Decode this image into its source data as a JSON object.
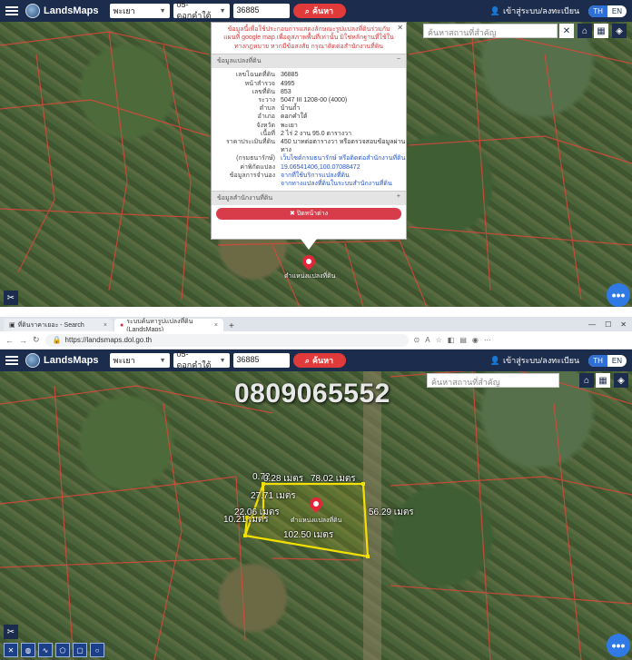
{
  "app": {
    "brand": "LandsMaps",
    "login": "เข้าสู่ระบบ/ลงทะเบียน",
    "lang_th": "TH",
    "lang_en": "EN"
  },
  "search": {
    "province": "พะเยา",
    "district": "05-ดอกคำใต้",
    "parcel_no": "36885",
    "button": "ค้นหา",
    "place_placeholder": "ค้นหาสถานที่สำคัญ"
  },
  "popup": {
    "note": "ข้อมูลนี้เพื่อใช้ประกอบการแสดงลักษณะรูปแปลงที่ดินร่วมกับแผนที่ google map เพื่อดูสภาพพื้นที่เท่านั้น มิใช่หลักฐานที่ใช้ในทางกฎหมาย หากมีข้อสงสัย กรุณาติดต่อสำนักงานที่ดิน",
    "section_parcel": "ข้อมูลแปลงที่ดิน",
    "section_office": "ข้อมูลสำนักงานที่ดิน",
    "collapse": "−",
    "expand": "+",
    "rows": [
      {
        "k": "เลขโฉนดที่ดิน",
        "v": "36885"
      },
      {
        "k": "หน้าสำรวจ",
        "v": "4995"
      },
      {
        "k": "เลขที่ดิน",
        "v": "853"
      },
      {
        "k": "ระวาง",
        "v": "5047 III 1208-00 (4000)"
      },
      {
        "k": "ตำบล",
        "v": "บ้านถ้ำ"
      },
      {
        "k": "อำเภอ",
        "v": "ดอกคำใต้"
      },
      {
        "k": "จังหวัด",
        "v": "พะเยา"
      },
      {
        "k": "เนื้อที่",
        "v": "2 ไร่ 2 งาน 95.0 ตารางวา"
      },
      {
        "k": "ราคาประเมินที่ดิน",
        "v": "450 บาทต่อตารางวา หรือตรวจสอบข้อมูลผ่านทาง"
      },
      {
        "k": "(กรมธนารักษ์)",
        "v": "เว็บไซต์กรมธนารักษ์ หรือติดต่อสำนักงานที่ดิน"
      },
      {
        "k": "ค่าพิกัดแปลง",
        "v": "19.06541406,100.07088472"
      },
      {
        "k": "ข้อมูลการจำนอง",
        "v": "จากที่ใช้บริการแปลงที่ดิน"
      },
      {
        "k": "",
        "v": "จากทางแปลงที่ดินในระบบสำนักงานที่ดิน"
      }
    ],
    "close_label": "✖ ปิดหน้าต่าง",
    "popup_close": "✕"
  },
  "pin_label": "ตำแหน่งแปลงที่ดิน",
  "browser": {
    "tab1": "ที่ดินราคาเยอะ - Search",
    "tab2": "ระบบค้นหารูปแปลงที่ดิน (LandsMaps)",
    "tab_close": "×",
    "newtab": "+",
    "url": "https://landsmaps.dol.go.th"
  },
  "overlay": {
    "phone": "0809065552",
    "m1": "0.72",
    "m2": "0.28 เมตร",
    "m3": "78.02 เมตร",
    "m4": "27.71 เมตร",
    "m5": "22.06 เมตร",
    "m6": "10.21 เมตร",
    "m7": "56.29 เมตร",
    "m8": "102.50 เมตร"
  },
  "fab": "•••"
}
